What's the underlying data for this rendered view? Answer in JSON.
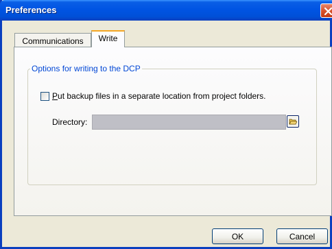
{
  "window": {
    "title": "Preferences"
  },
  "tabs": [
    {
      "label": "Communications",
      "active": false
    },
    {
      "label": "Write",
      "active": true
    }
  ],
  "group": {
    "legend": "Options for writing to the DCP",
    "checkbox": {
      "mnemonic": "P",
      "label_rest": "ut backup files in a separate location from project folders.",
      "checked": false
    },
    "directory": {
      "label": "Directory:",
      "value": ""
    }
  },
  "buttons": {
    "ok": "OK",
    "cancel": "Cancel"
  },
  "icons": {
    "close": "close-icon",
    "browse": "folder-open-icon"
  },
  "colors": {
    "titlebar": "#0054e3",
    "legend": "#0046d5",
    "close": "#d9532c",
    "accent_tab": "#f5a623"
  }
}
